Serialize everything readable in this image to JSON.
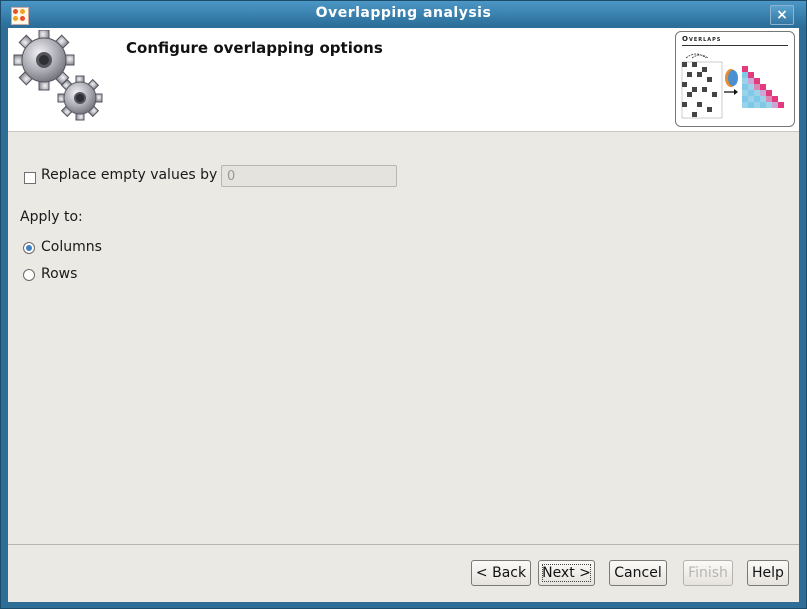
{
  "window": {
    "title": "Overlapping analysis",
    "close_glyph": "×"
  },
  "banner": {
    "title": "Configure overlapping options",
    "preview_label": "Overlaps"
  },
  "options": {
    "replace_label": "Replace empty values by",
    "replace_checked": false,
    "replace_value": "0",
    "apply_to_label": "Apply to:",
    "apply_options": [
      {
        "label": "Columns",
        "selected": true
      },
      {
        "label": "Rows",
        "selected": false
      }
    ]
  },
  "buttons": {
    "back": "< Back",
    "next": "Next >",
    "cancel": "Cancel",
    "finish": "Finish",
    "help": "Help"
  },
  "icons": {
    "app": "app-logo-icon",
    "close": "close-icon",
    "gears": "gears-icon",
    "preview": "overlaps-preview-icon"
  }
}
